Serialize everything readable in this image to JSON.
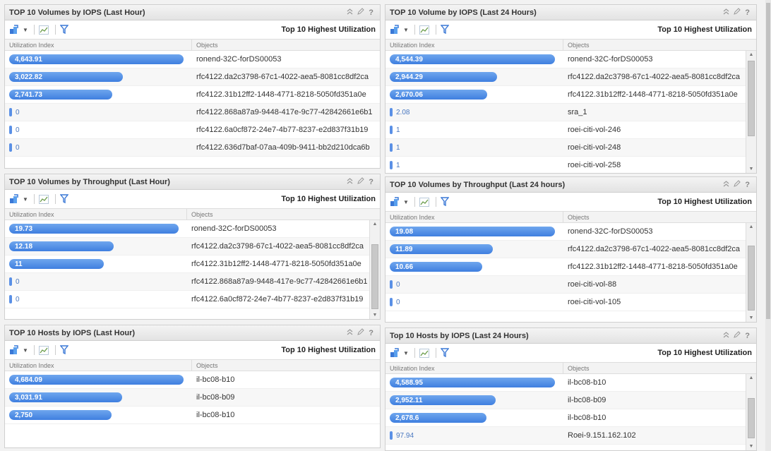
{
  "toolbar": {
    "right_label": "Top 10 Highest Utilization"
  },
  "columns": {
    "util": "Utilization Index",
    "objects": "Objects"
  },
  "panels": [
    {
      "title": "TOP 10 Volumes by IOPS (Last Hour)",
      "rows": [
        {
          "value": "4,643.91",
          "fraction": 1.0,
          "object": "ronend-32C-forDS00053"
        },
        {
          "value": "3,022.82",
          "fraction": 0.651,
          "object": "rfc4122.da2c3798-67c1-4022-aea5-8081cc8df2ca"
        },
        {
          "value": "2,741.73",
          "fraction": 0.59,
          "object": "rfc4122.31b12ff2-1448-4771-8218-5050fd351a0e"
        },
        {
          "value": "0",
          "fraction": 0,
          "object": "rfc4122.868a87a9-9448-417e-9c77-42842661e6b1"
        },
        {
          "value": "0",
          "fraction": 0,
          "object": "rfc4122.6a0cf872-24e7-4b77-8237-e2d837f31b19"
        },
        {
          "value": "0",
          "fraction": 0,
          "object": "rfc4122.636d7baf-07aa-409b-9411-bb2d210dca6b"
        }
      ]
    },
    {
      "title": "TOP 10 Volume by IOPS (Last 24 Hours)",
      "rows": [
        {
          "value": "4,544.39",
          "fraction": 1.0,
          "object": "ronend-32C-forDS00053"
        },
        {
          "value": "2,944.29",
          "fraction": 0.648,
          "object": "rfc4122.da2c3798-67c1-4022-aea5-8081cc8df2ca"
        },
        {
          "value": "2,670.06",
          "fraction": 0.588,
          "object": "rfc4122.31b12ff2-1448-4771-8218-5050fd351a0e"
        },
        {
          "value": "2.08",
          "fraction": 0,
          "object": "sra_1"
        },
        {
          "value": "1",
          "fraction": 0,
          "object": "roei-citi-vol-246"
        },
        {
          "value": "1",
          "fraction": 0,
          "object": "roei-citi-vol-248"
        },
        {
          "value": "1",
          "fraction": 0,
          "object": "roei-citi-vol-258"
        }
      ]
    },
    {
      "title": "TOP 10 Volumes by Throughput (Last Hour)",
      "rows": [
        {
          "value": "19.73",
          "fraction": 1.0,
          "object": "ronend-32C-forDS00053"
        },
        {
          "value": "12.18",
          "fraction": 0.617,
          "object": "rfc4122.da2c3798-67c1-4022-aea5-8081cc8df2ca"
        },
        {
          "value": "11",
          "fraction": 0.557,
          "object": "rfc4122.31b12ff2-1448-4771-8218-5050fd351a0e"
        },
        {
          "value": "0",
          "fraction": 0,
          "object": "rfc4122.868a87a9-9448-417e-9c77-42842661e6b1"
        },
        {
          "value": "0",
          "fraction": 0,
          "object": "rfc4122.6a0cf872-24e7-4b77-8237-e2d837f31b19"
        }
      ]
    },
    {
      "title": "TOP 10 Volumes by Throughput (Last 24 hours)",
      "rows": [
        {
          "value": "19.08",
          "fraction": 1.0,
          "object": "ronend-32C-forDS00053"
        },
        {
          "value": "11.89",
          "fraction": 0.623,
          "object": "rfc4122.da2c3798-67c1-4022-aea5-8081cc8df2ca"
        },
        {
          "value": "10.66",
          "fraction": 0.559,
          "object": "rfc4122.31b12ff2-1448-4771-8218-5050fd351a0e"
        },
        {
          "value": "0",
          "fraction": 0,
          "object": "roei-citi-vol-88"
        },
        {
          "value": "0",
          "fraction": 0,
          "object": "roei-citi-vol-105"
        }
      ]
    },
    {
      "title": "TOP 10 Hosts by IOPS (Last Hour)",
      "rows": [
        {
          "value": "4,684.09",
          "fraction": 1.0,
          "object": "il-bc08-b10"
        },
        {
          "value": "3,031.91",
          "fraction": 0.647,
          "object": "il-bc08-b09"
        },
        {
          "value": "2,750",
          "fraction": 0.587,
          "object": "il-bc08-b10"
        }
      ]
    },
    {
      "title": "Top 10 Hosts by IOPS (Last 24 Hours)",
      "rows": [
        {
          "value": "4,588.95",
          "fraction": 1.0,
          "object": "il-bc08-b10"
        },
        {
          "value": "2,952.11",
          "fraction": 0.643,
          "object": "il-bc08-b09"
        },
        {
          "value": "2,678.6",
          "fraction": 0.584,
          "object": "il-bc08-b10"
        },
        {
          "value": "97.94",
          "fraction": 0,
          "object": "Roei-9.151.162.102"
        }
      ]
    }
  ],
  "icons": {
    "chart_type": "chart-type-icon",
    "line_chart": "line-chart-icon",
    "filter": "filter-icon",
    "collapse": "collapse-icon",
    "edit": "edit-icon",
    "help": "help-icon"
  }
}
